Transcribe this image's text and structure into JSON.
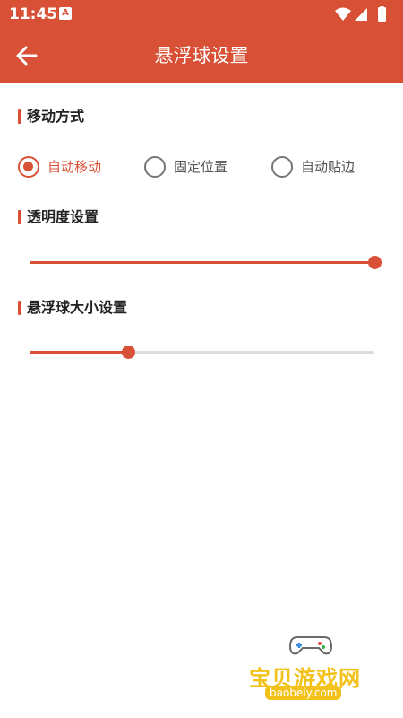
{
  "status_bar": {
    "time": "11:45",
    "notification_badge": "A",
    "icons": [
      "wifi-icon",
      "signal-icon",
      "battery-icon"
    ]
  },
  "app_bar": {
    "title": "悬浮球设置",
    "back_icon": "back-arrow-icon"
  },
  "move_mode": {
    "title": "移动方式",
    "options": [
      {
        "label": "自动移动",
        "selected": true
      },
      {
        "label": "固定位置",
        "selected": false
      },
      {
        "label": "自动贴边",
        "selected": false
      }
    ]
  },
  "opacity": {
    "title": "透明度设置",
    "value": 1.0
  },
  "ball_size": {
    "title": "悬浮球大小设置",
    "value": 0.285
  },
  "watermark": {
    "brand": "宝贝游戏网",
    "url": "baobeiy.com",
    "icon": "gamepad-icon"
  },
  "colors": {
    "accent": "#d85035",
    "track": "#dddddd"
  }
}
